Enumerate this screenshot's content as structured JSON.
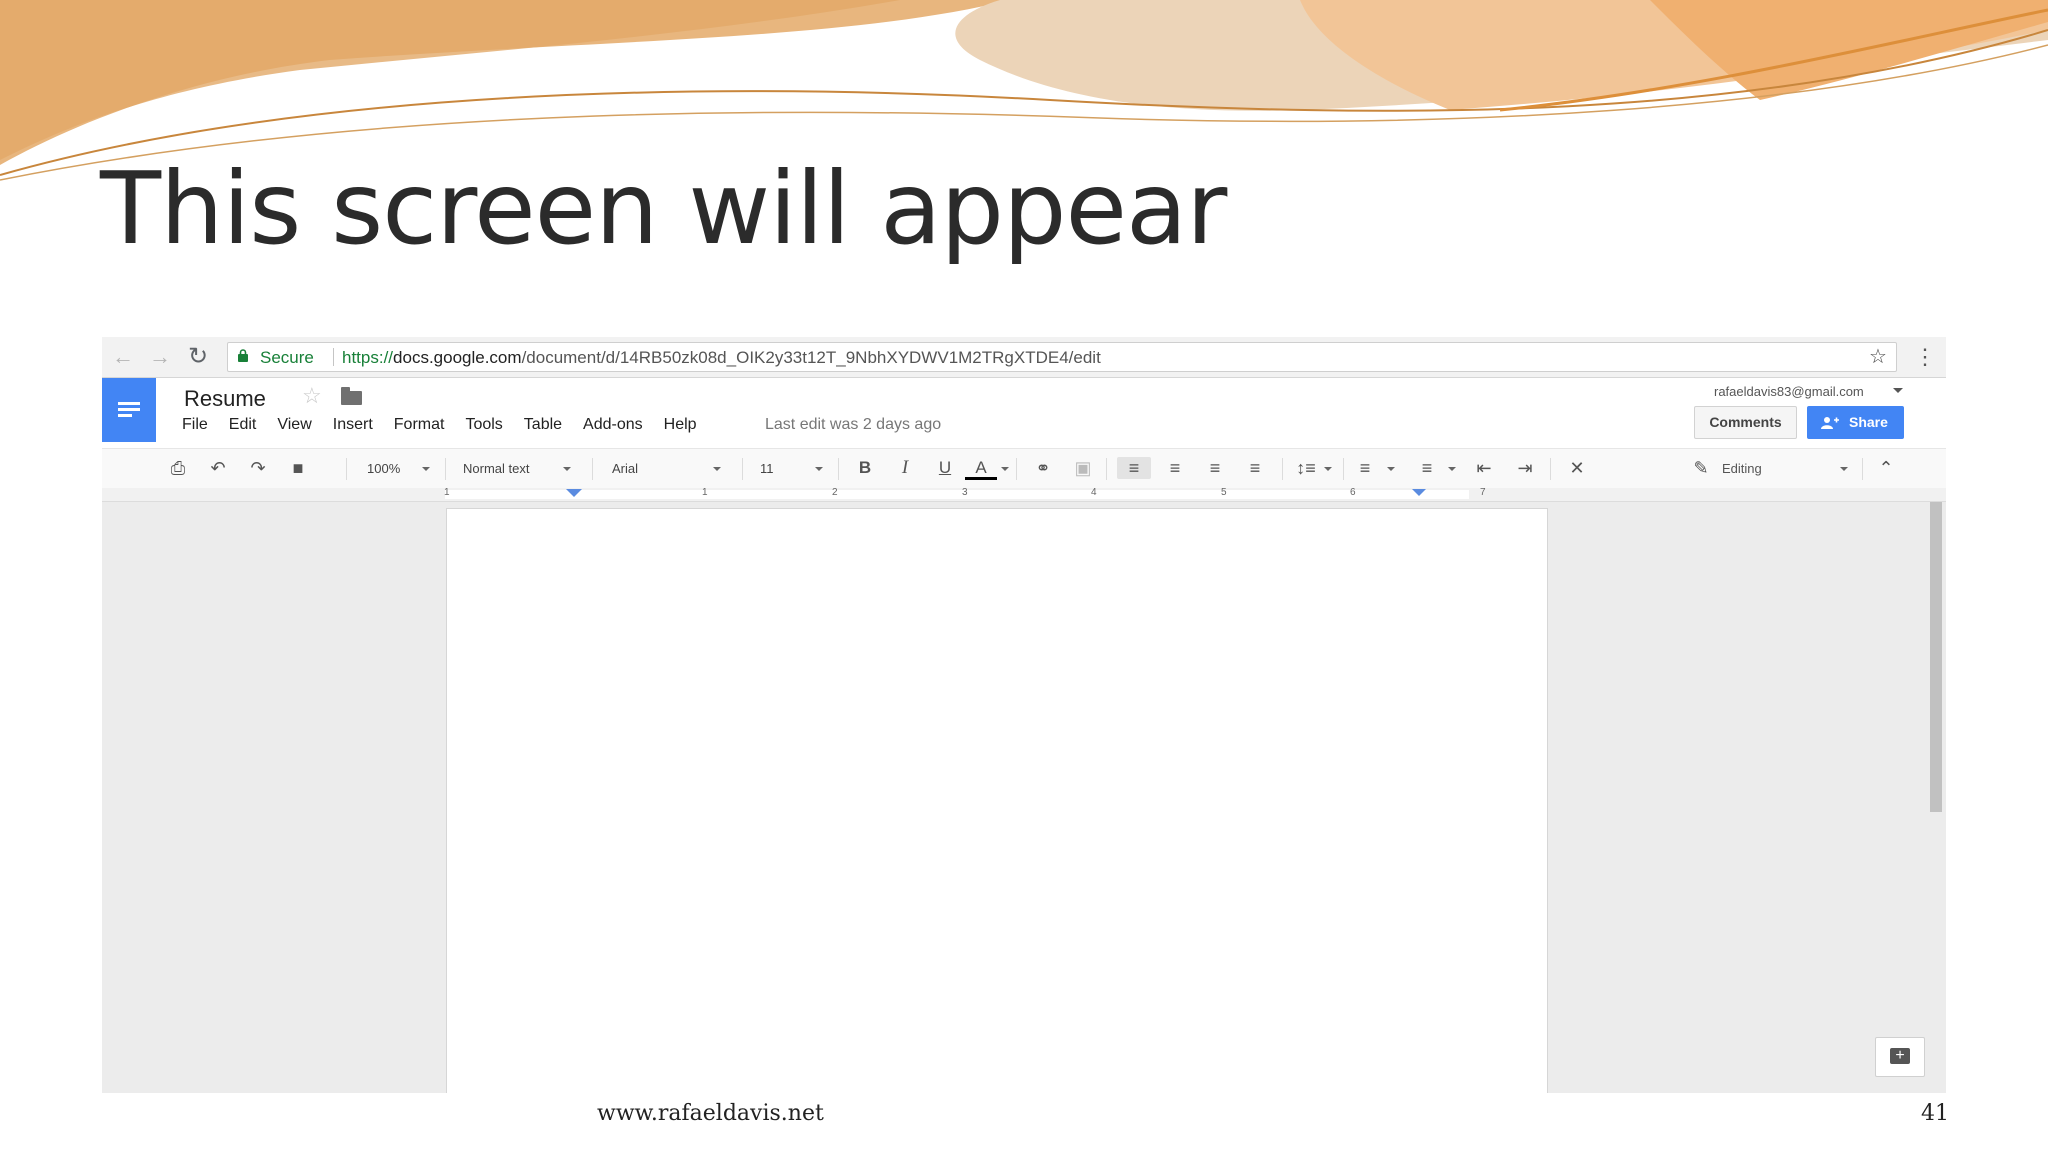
{
  "slide": {
    "title": "This screen will appear",
    "footer_url": "www.rafaeldavis.net",
    "page_number": "41"
  },
  "browser": {
    "secure_label": "Secure",
    "url_protocol": "https://",
    "url_host": "docs.google.com",
    "url_path": "/document/d/14RB50zk08d_OIK2y33t12T_9NbhXYDWV1M2TRgXTDE4/edit"
  },
  "docs": {
    "title": "Resume",
    "menu": [
      "File",
      "Edit",
      "View",
      "Insert",
      "Format",
      "Tools",
      "Table",
      "Add-ons",
      "Help"
    ],
    "last_edit": "Last edit was 2 days ago",
    "account": "rafaeldavis83@gmail.com",
    "comments_label": "Comments",
    "share_label": "Share"
  },
  "toolbar": {
    "zoom": "100%",
    "style": "Normal text",
    "font": "Arial",
    "font_size": "11",
    "mode": "Editing"
  },
  "ruler": {
    "numbers": [
      "1",
      "1",
      "2",
      "3",
      "4",
      "5",
      "6",
      "7"
    ]
  },
  "colors": {
    "docs_blue": "#4285f4",
    "secure_green": "#188038",
    "swoosh_orange": "#e9a34f"
  }
}
